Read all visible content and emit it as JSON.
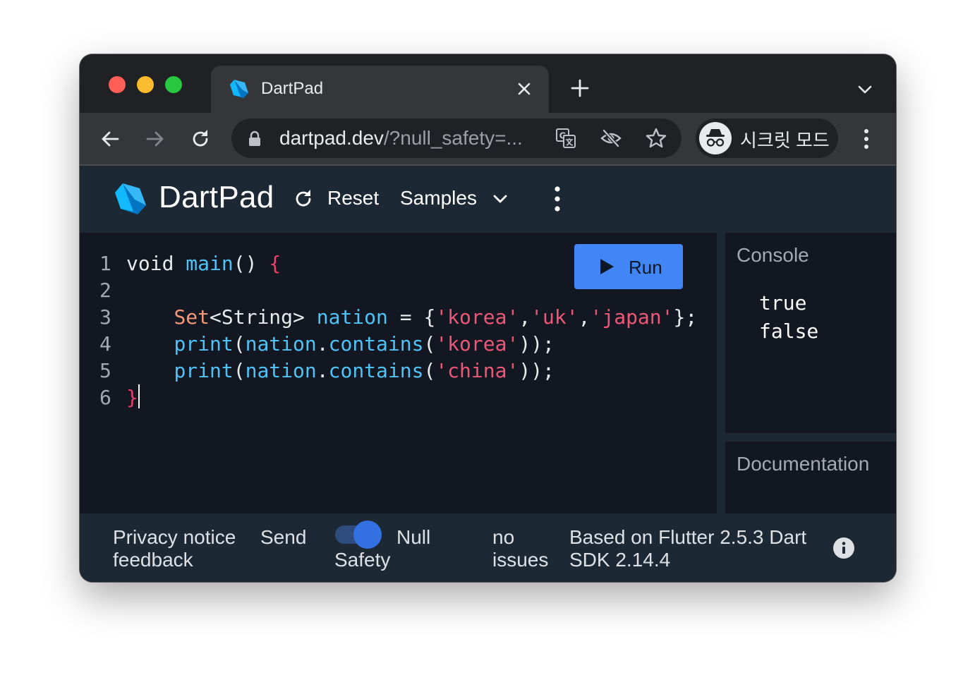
{
  "browser": {
    "tab_title": "DartPad",
    "url_host": "dartpad.dev",
    "url_rest": "/?null_safety=...",
    "incognito_label": "시크릿 모드"
  },
  "app": {
    "title": "DartPad",
    "reset_label": "Reset",
    "samples_label": "Samples",
    "run_label": "Run",
    "console_title": "Console",
    "docs_title": "Documentation",
    "console_output": "true\nfalse"
  },
  "code": {
    "line_numbers": [
      "1",
      "2",
      "3",
      "4",
      "5",
      "6"
    ],
    "l1": {
      "t1": "void",
      "t2": "main",
      "t3": "()",
      "t4": "{"
    },
    "l3": {
      "type": "Set",
      "t1": "<String>",
      "var": "nation",
      "eq": "=",
      "ob": "{",
      "s1": "'korea'",
      "c1": ",",
      "s2": "'uk'",
      "c2": ",",
      "s3": "'japan'",
      "cb": "};"
    },
    "l4": {
      "fn": "print",
      "p1": "(",
      "obj": "nation",
      "dot": ".",
      "method": "contains",
      "p2": "(",
      "str": "'korea'",
      "end": "));"
    },
    "l5": {
      "fn": "print",
      "p1": "(",
      "obj": "nation",
      "dot": ".",
      "method": "contains",
      "p2": "(",
      "str": "'china'",
      "end": "));"
    },
    "l6": {
      "brace": "}"
    }
  },
  "footer": {
    "privacy": "Privacy notice",
    "send": "Send",
    "feedback": "feedback",
    "null_word": "Null",
    "safety_word": "Safety",
    "issues": "no issues",
    "sdk_info": "Based on Flutter 2.5.3 Dart SDK 2.14.4"
  },
  "toggle": {
    "null_safety_on": true
  },
  "icons": {
    "nav": [
      "back-arrow-icon",
      "forward-arrow-icon",
      "reload-icon"
    ],
    "omnibox": [
      "lock-icon",
      "translate-icon",
      "eye-off-icon",
      "star-icon"
    ],
    "app": [
      "dart-logo-icon",
      "refresh-icon",
      "chevron-down-icon",
      "more-vert-icon",
      "play-icon",
      "info-icon"
    ]
  },
  "colors": {
    "run_button": "#4285f4",
    "toggle_accent": "#3371e2",
    "keyword_fn": "#4fc3f7",
    "string": "#ef5777",
    "type": "#f4987a"
  }
}
